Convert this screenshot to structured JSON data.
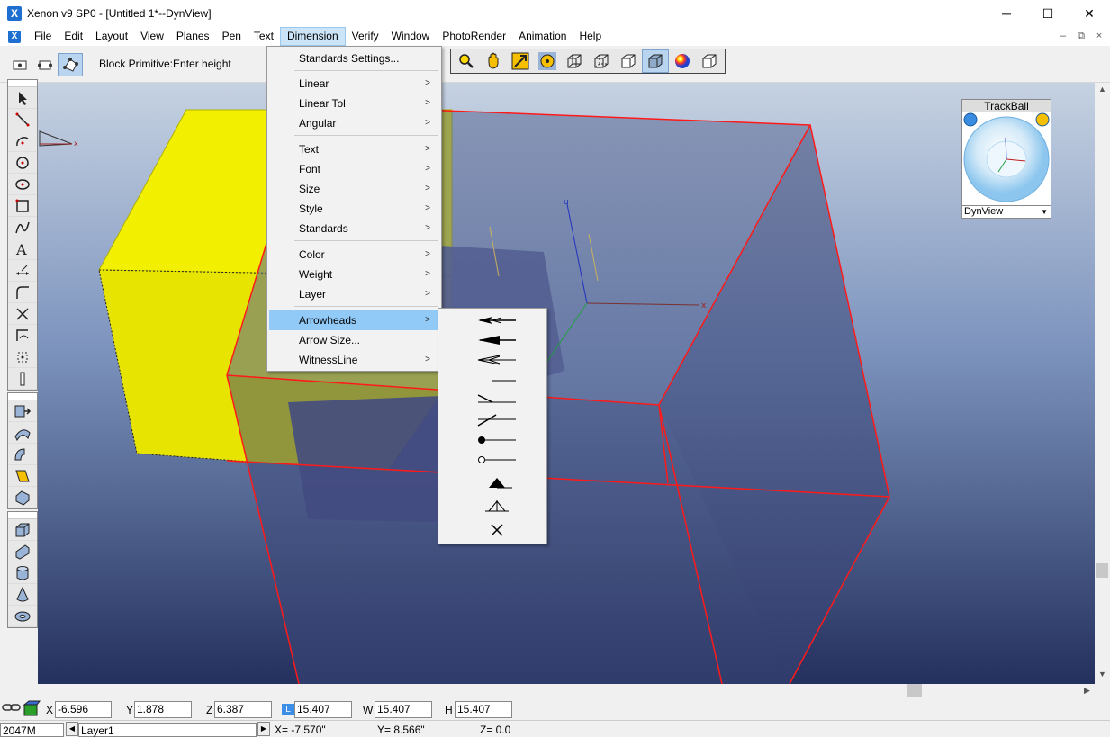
{
  "window": {
    "title": "Xenon v9 SP0 - [Untitled 1*--DynView]",
    "app_icon": "X",
    "minimize": "─",
    "maximize": "☐",
    "close": "✕"
  },
  "menubar": {
    "items": [
      "File",
      "Edit",
      "Layout",
      "View",
      "Planes",
      "Pen",
      "Text",
      "Dimension",
      "Verify",
      "Window",
      "PhotoRender",
      "Animation",
      "Help"
    ],
    "active": "Dimension",
    "mdi": [
      "–",
      "⧉",
      "×"
    ]
  },
  "toolbar": {
    "prompt": "Block Primitive:Enter height"
  },
  "dimension_menu": {
    "items": [
      {
        "label": "Standards Settings...",
        "submenu": false
      },
      {
        "label": "Linear",
        "submenu": true
      },
      {
        "label": "Linear Tol",
        "submenu": true
      },
      {
        "label": "Angular",
        "submenu": true
      },
      {
        "label": "Text",
        "submenu": true
      },
      {
        "label": "Font",
        "submenu": true
      },
      {
        "label": "Size",
        "submenu": true
      },
      {
        "label": "Style",
        "submenu": true
      },
      {
        "label": "Standards",
        "submenu": true
      },
      {
        "label": "Color",
        "submenu": true
      },
      {
        "label": "Weight",
        "submenu": true
      },
      {
        "label": "Layer",
        "submenu": true
      },
      {
        "label": "Arrowheads",
        "submenu": true,
        "highlighted": true
      },
      {
        "label": "Arrow Size...",
        "submenu": false
      },
      {
        "label": "WitnessLine",
        "submenu": true
      }
    ],
    "submenu_arrow": ">"
  },
  "arrowheads_submenu": {
    "items": [
      "arrow-open-double-icon",
      "arrow-filled-icon",
      "arrow-open-icon",
      "arrow-none-icon",
      "arrow-slash-icon",
      "arrow-tick-icon",
      "arrow-dot-filled-icon",
      "arrow-dot-open-icon",
      "arrow-triangle-filled-icon",
      "arrow-triangle-open-icon",
      "arrow-cross-icon"
    ]
  },
  "trackball": {
    "title": "TrackBall",
    "view": "DynView"
  },
  "coordinates": {
    "x_label": "X",
    "x": "-6.596",
    "y_label": "Y",
    "y": "1.878",
    "z_label": "Z",
    "z": "6.387",
    "l_label": "L",
    "l": "15.407",
    "w_label": "W",
    "w": "15.407",
    "h_label": "H",
    "h": "15.407"
  },
  "status": {
    "memory": "2047M 2047M",
    "layer": "Layer1",
    "x_text": "X=  -7.570\"",
    "y_text": "Y=   8.566\"",
    "z_text": "Z=     0.0"
  },
  "colors": {
    "menu_highlight": "#91c9f7",
    "active_menu": "#cce4f7",
    "yellow_block": "#f2f000",
    "edge_red": "#ff1a1a",
    "viewport_top": "#c6d2e2",
    "viewport_bottom": "#24305e"
  }
}
